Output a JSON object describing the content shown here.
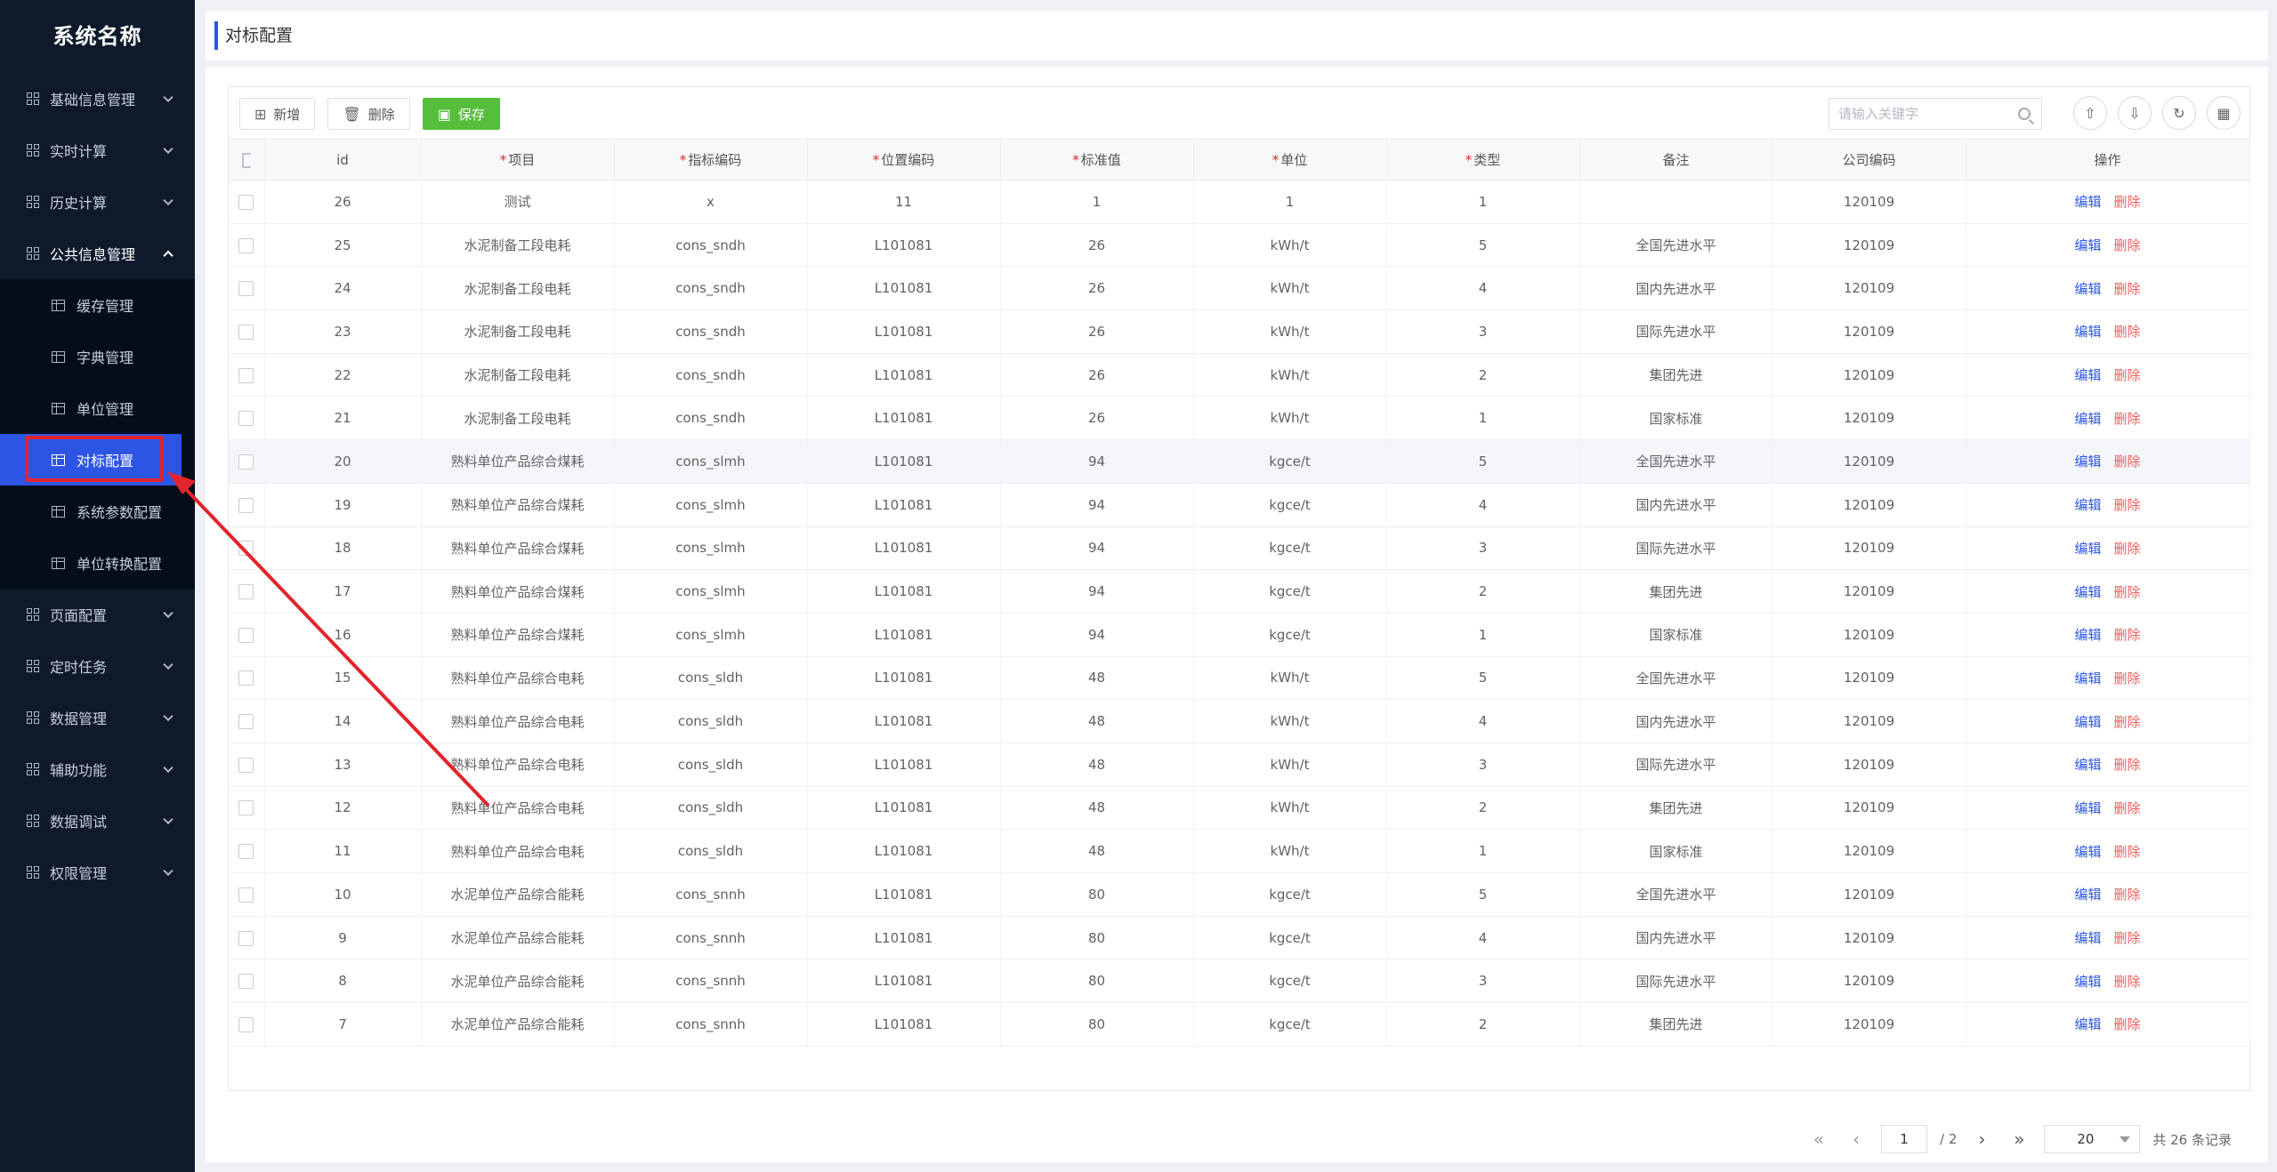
{
  "sidebar": {
    "title": "系统名称",
    "menu": [
      {
        "label": "基础信息管理"
      },
      {
        "label": "实时计算"
      },
      {
        "label": "历史计算"
      },
      {
        "label": "公共信息管理"
      },
      {
        "label": "页面配置"
      },
      {
        "label": "定时任务"
      },
      {
        "label": "数据管理"
      },
      {
        "label": "辅助功能"
      },
      {
        "label": "数据调试"
      },
      {
        "label": "权限管理"
      }
    ],
    "submenu": [
      {
        "label": "缓存管理"
      },
      {
        "label": "字典管理"
      },
      {
        "label": "单位管理"
      },
      {
        "label": "对标配置"
      },
      {
        "label": "系统参数配置"
      },
      {
        "label": "单位转换配置"
      }
    ]
  },
  "header": {
    "title": "对标配置"
  },
  "toolbar": {
    "add_label": "新增",
    "delete_label": "删除",
    "save_label": "保存"
  },
  "search": {
    "placeholder": "请输入关键字"
  },
  "table": {
    "columns": [
      "id",
      "项目",
      "指标编码",
      "位置编码",
      "标准值",
      "单位",
      "类型",
      "备注",
      "公司编码",
      "操作"
    ],
    "edit_label": "编辑",
    "delete_label": "删除",
    "rows": [
      [
        "26",
        "测试",
        "x",
        "11",
        "1",
        "1",
        "1",
        "",
        "120109"
      ],
      [
        "25",
        "水泥制备工段电耗",
        "cons_sndh",
        "L101081",
        "26",
        "kWh/t",
        "5",
        "全国先进水平",
        "120109"
      ],
      [
        "24",
        "水泥制备工段电耗",
        "cons_sndh",
        "L101081",
        "26",
        "kWh/t",
        "4",
        "国内先进水平",
        "120109"
      ],
      [
        "23",
        "水泥制备工段电耗",
        "cons_sndh",
        "L101081",
        "26",
        "kWh/t",
        "3",
        "国际先进水平",
        "120109"
      ],
      [
        "22",
        "水泥制备工段电耗",
        "cons_sndh",
        "L101081",
        "26",
        "kWh/t",
        "2",
        "集团先进",
        "120109"
      ],
      [
        "21",
        "水泥制备工段电耗",
        "cons_sndh",
        "L101081",
        "26",
        "kWh/t",
        "1",
        "国家标准",
        "120109"
      ],
      [
        "20",
        "熟料单位产品综合煤耗",
        "cons_slmh",
        "L101081",
        "94",
        "kgce/t",
        "5",
        "全国先进水平",
        "120109"
      ],
      [
        "19",
        "熟料单位产品综合煤耗",
        "cons_slmh",
        "L101081",
        "94",
        "kgce/t",
        "4",
        "国内先进水平",
        "120109"
      ],
      [
        "18",
        "熟料单位产品综合煤耗",
        "cons_slmh",
        "L101081",
        "94",
        "kgce/t",
        "3",
        "国际先进水平",
        "120109"
      ],
      [
        "17",
        "熟料单位产品综合煤耗",
        "cons_slmh",
        "L101081",
        "94",
        "kgce/t",
        "2",
        "集团先进",
        "120109"
      ],
      [
        "16",
        "熟料单位产品综合煤耗",
        "cons_slmh",
        "L101081",
        "94",
        "kgce/t",
        "1",
        "国家标准",
        "120109"
      ],
      [
        "15",
        "熟料单位产品综合电耗",
        "cons_sldh",
        "L101081",
        "48",
        "kWh/t",
        "5",
        "全国先进水平",
        "120109"
      ],
      [
        "14",
        "熟料单位产品综合电耗",
        "cons_sldh",
        "L101081",
        "48",
        "kWh/t",
        "4",
        "国内先进水平",
        "120109"
      ],
      [
        "13",
        "熟料单位产品综合电耗",
        "cons_sldh",
        "L101081",
        "48",
        "kWh/t",
        "3",
        "国际先进水平",
        "120109"
      ],
      [
        "12",
        "熟料单位产品综合电耗",
        "cons_sldh",
        "L101081",
        "48",
        "kWh/t",
        "2",
        "集团先进",
        "120109"
      ],
      [
        "11",
        "熟料单位产品综合电耗",
        "cons_sldh",
        "L101081",
        "48",
        "kWh/t",
        "1",
        "国家标准",
        "120109"
      ],
      [
        "10",
        "水泥单位产品综合能耗",
        "cons_snnh",
        "L101081",
        "80",
        "kgce/t",
        "5",
        "全国先进水平",
        "120109"
      ],
      [
        "9",
        "水泥单位产品综合能耗",
        "cons_snnh",
        "L101081",
        "80",
        "kgce/t",
        "4",
        "国内先进水平",
        "120109"
      ],
      [
        "8",
        "水泥单位产品综合能耗",
        "cons_snnh",
        "L101081",
        "80",
        "kgce/t",
        "3",
        "国际先进水平",
        "120109"
      ],
      [
        "7",
        "水泥单位产品综合能耗",
        "cons_snnh",
        "L101081",
        "80",
        "kgce/t",
        "2",
        "集团先进",
        "120109"
      ]
    ]
  },
  "pagination": {
    "current_page": "1",
    "total_pages": "/ 2",
    "page_size": "20",
    "total_text": "共 26 条记录"
  },
  "colors": {
    "accent": "#2d55e4",
    "save": "#57be3c",
    "danger": "#f25a5a",
    "sidebar_bg": "#0e1a2c",
    "annotation": "#e3242b"
  }
}
